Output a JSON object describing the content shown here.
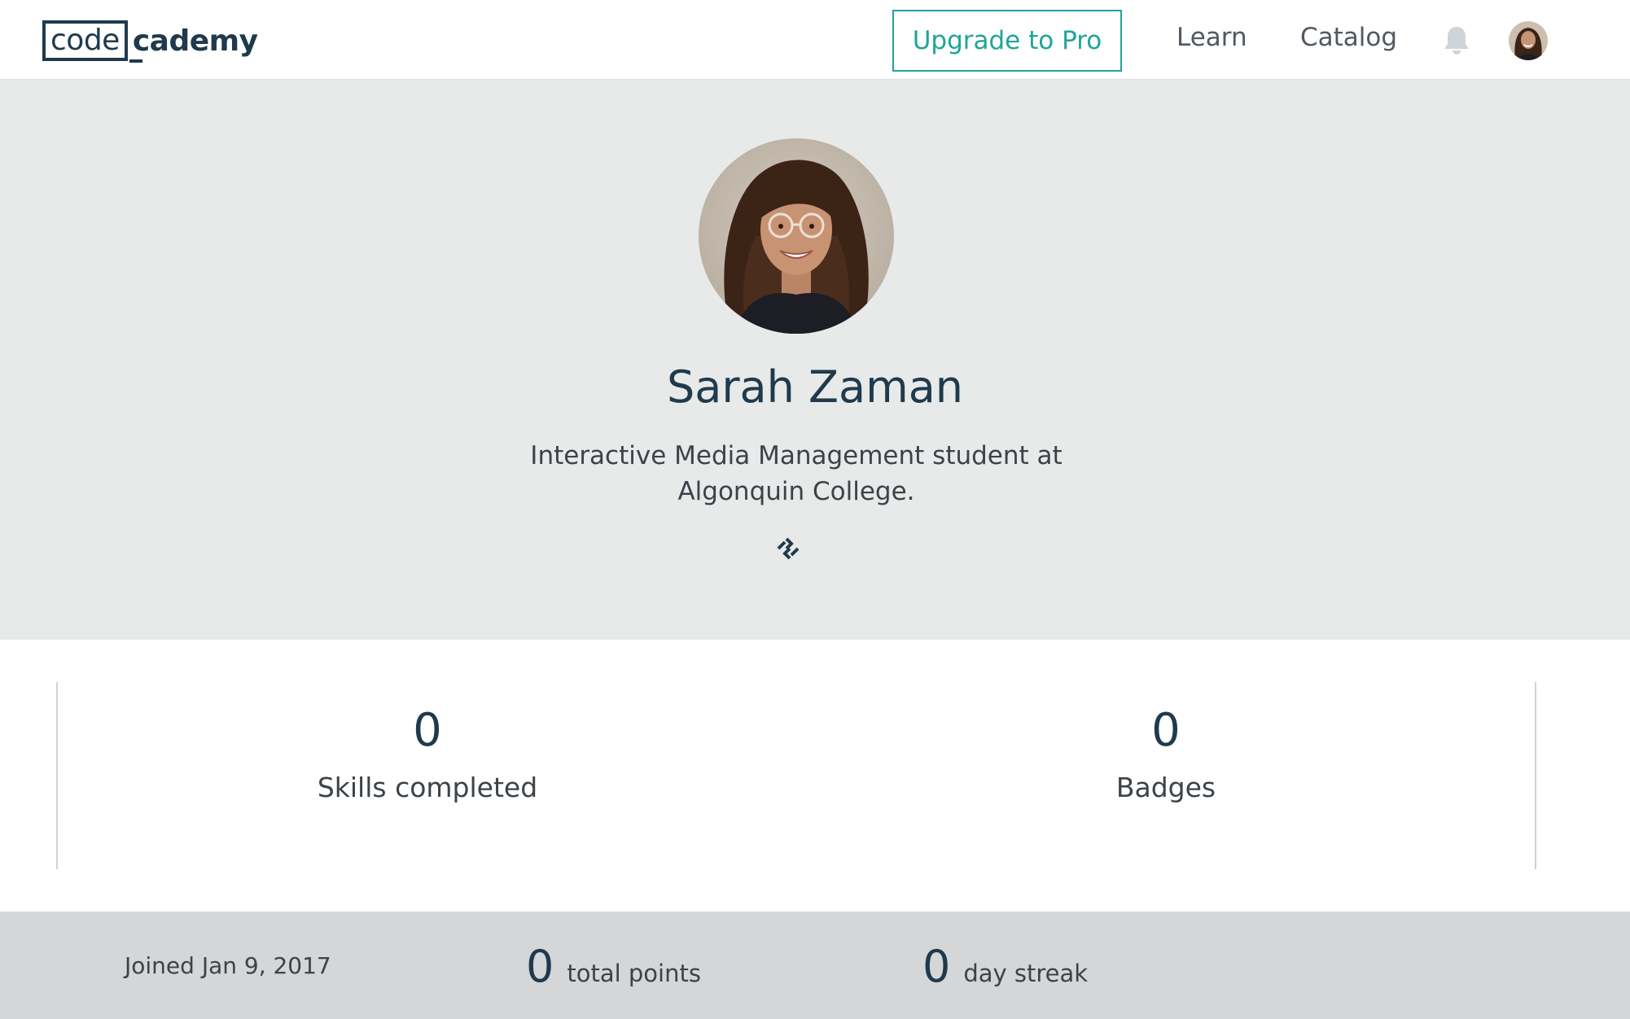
{
  "header": {
    "logo": {
      "boxed_text": "code",
      "rest_text": "cademy"
    },
    "upgrade_label": "Upgrade to Pro",
    "nav": {
      "learn": "Learn",
      "catalog": "Catalog"
    },
    "icons": {
      "bell": "bell-icon",
      "avatar": "user-avatar"
    }
  },
  "profile": {
    "name": "Sarah Zaman",
    "bio": "Interactive Media Management student at Algonquin College.",
    "link_icon": "link-icon"
  },
  "stats": {
    "skills_completed": {
      "value": "0",
      "label": "Skills completed"
    },
    "badges": {
      "value": "0",
      "label": "Badges"
    }
  },
  "footer": {
    "joined": "Joined Jan 9, 2017",
    "total_points": {
      "value": "0",
      "label": "total points"
    },
    "day_streak": {
      "value": "0",
      "label": "day streak"
    }
  },
  "colors": {
    "brand_navy": "#1f3a4d",
    "accent_teal": "#1fa59a",
    "hero_bg": "#e8e9e9",
    "footer_bg": "#d4d6d8"
  }
}
